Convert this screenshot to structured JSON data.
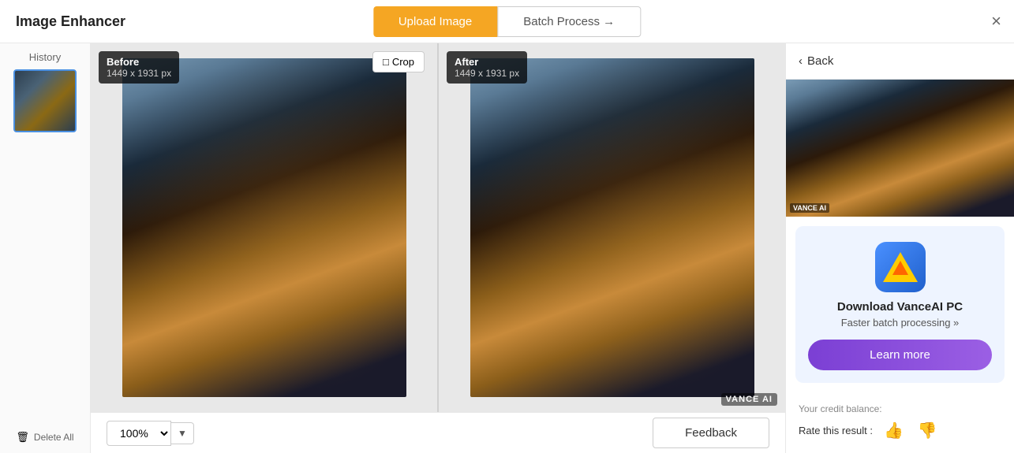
{
  "app": {
    "title": "Image Enhancer"
  },
  "header": {
    "upload_label": "Upload Image",
    "batch_label": "Batch Process →",
    "close_label": "×"
  },
  "sidebar": {
    "history_label": "History",
    "delete_label": "Delete All"
  },
  "before_panel": {
    "label": "Before",
    "dimensions": "1449 x 1931 px",
    "crop_label": "Crop"
  },
  "after_panel": {
    "label": "After",
    "dimensions": "1449 x 1931 px",
    "watermark": "VANCE AI"
  },
  "viewer_bottom": {
    "zoom_value": "100%",
    "feedback_label": "Feedback"
  },
  "right_panel": {
    "back_label": "Back",
    "watermark": "VANCE AI",
    "ad": {
      "title": "Download VanceAI PC",
      "subtitle": "Faster batch processing »",
      "learn_more_label": "Learn more"
    },
    "credit_label": "Your credit balance:",
    "rate_label": "Rate this result :"
  }
}
